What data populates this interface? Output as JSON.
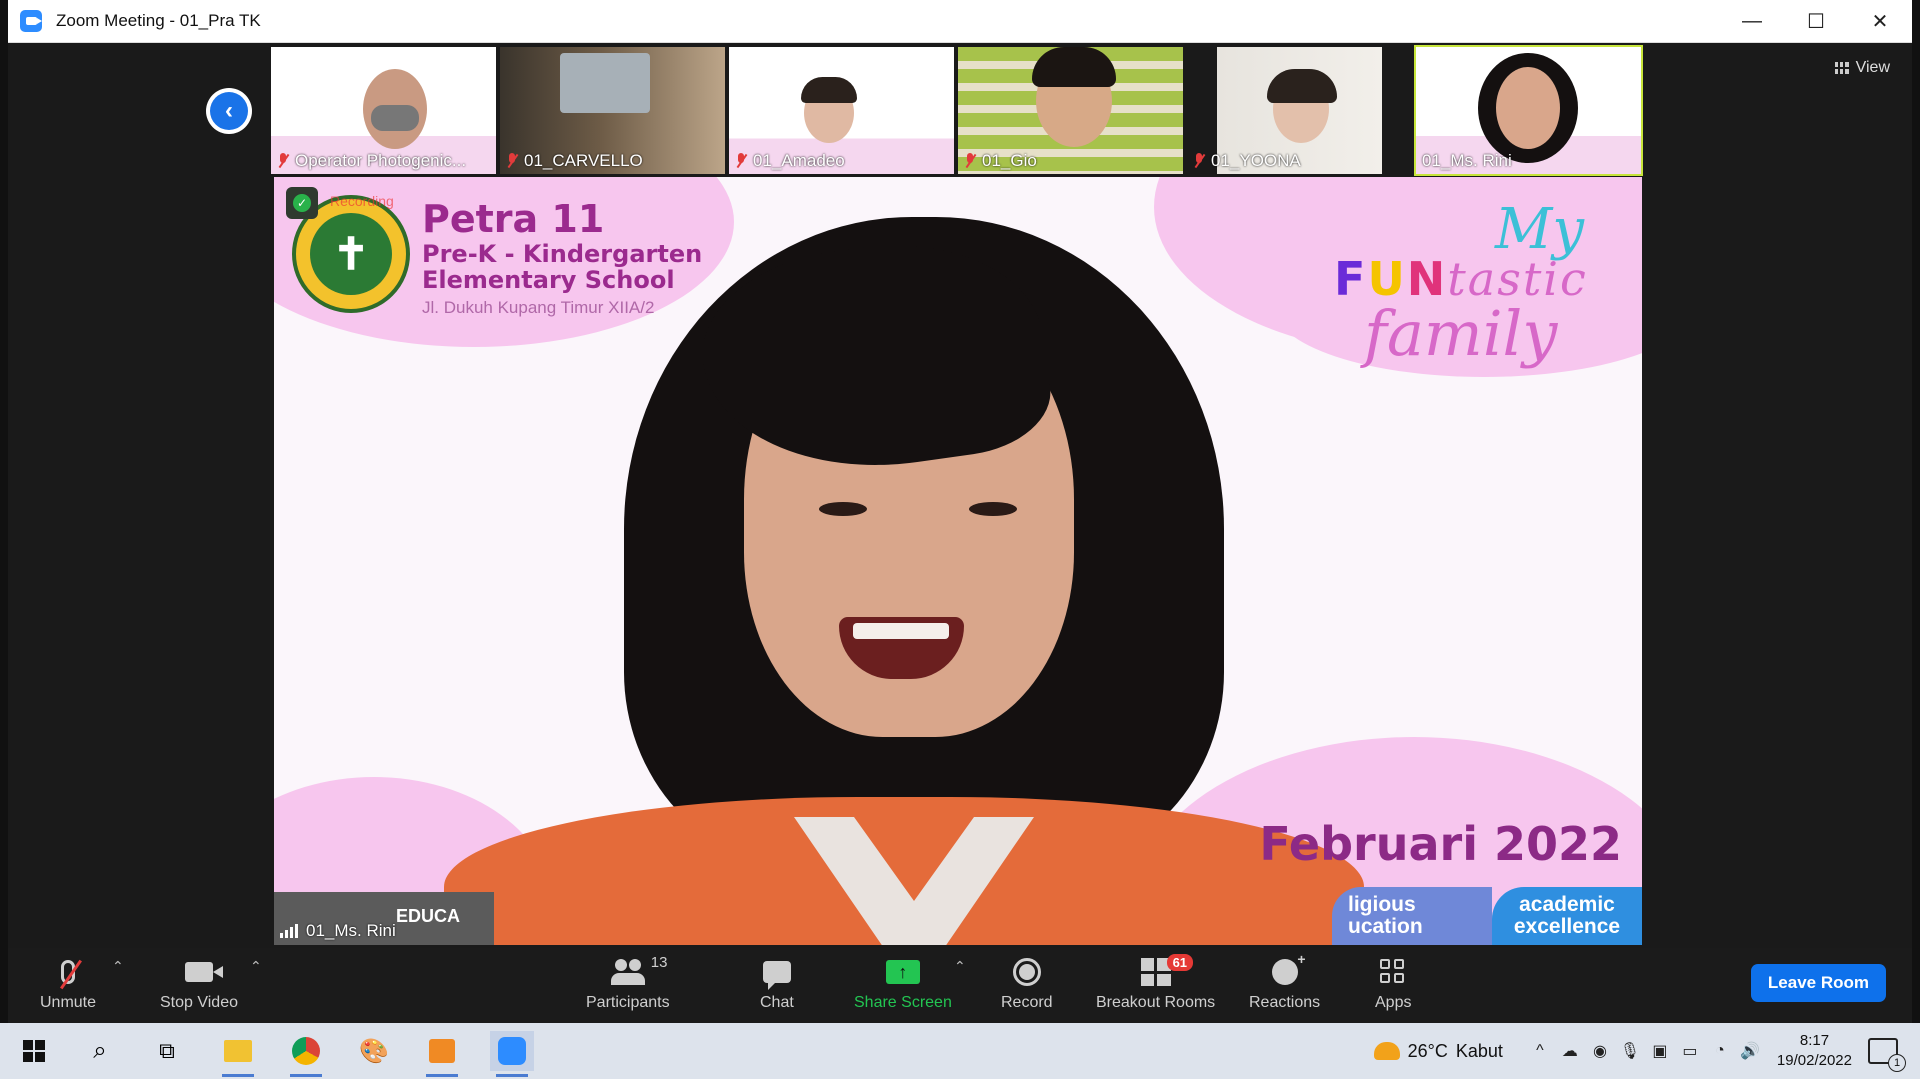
{
  "window": {
    "title": "Zoom Meeting - 01_Pra TK",
    "minimize": "—",
    "maximize": "☐",
    "close": "✕"
  },
  "view_button": {
    "label": "View"
  },
  "thumbnails": [
    {
      "name": "Operator Photogenic...",
      "muted": true
    },
    {
      "name": "01_CARVELLO",
      "muted": true
    },
    {
      "name": "01_Amadeo",
      "muted": true
    },
    {
      "name": "01_Gio",
      "muted": true
    },
    {
      "name": "01_YOONA",
      "muted": true
    },
    {
      "name": "01_Ms. Rini",
      "muted": false
    }
  ],
  "main_video": {
    "speaker_name": "01_Ms. Rini",
    "recording_label": "Recording",
    "school": {
      "name": "Petra 11",
      "line2": "Pre-K  - Kindergarten",
      "line3": "Elementary School",
      "address": "Jl. Dukuh Kupang Timur XIIA/2",
      "seal_mark": "✝"
    },
    "logo": {
      "my": "My",
      "fun_letters": [
        "F",
        "U",
        "N",
        "tastic"
      ],
      "family": "family"
    },
    "date_banner": "Februari 2022",
    "pill_left": "ligious\nucation",
    "pill_right": "academic excellence",
    "bottom_text": "EDUCA"
  },
  "toolbar": {
    "unmute": "Unmute",
    "stop_video": "Stop Video",
    "participants": "Participants",
    "participants_count": "13",
    "chat": "Chat",
    "share_screen": "Share Screen",
    "record": "Record",
    "breakout_rooms": "Breakout Rooms",
    "breakout_badge": "61",
    "reactions": "Reactions",
    "apps": "Apps",
    "leave": "Leave Room"
  },
  "taskbar": {
    "weather_temp": "26°C",
    "weather_text": "Kabut",
    "time": "8:17",
    "date": "19/02/2022",
    "notifications": "1"
  },
  "colors": {
    "accent": "#0e71eb",
    "share_green": "#23c552",
    "mute_red": "#e23b3b",
    "pink_bg": "#f7c6ee"
  }
}
